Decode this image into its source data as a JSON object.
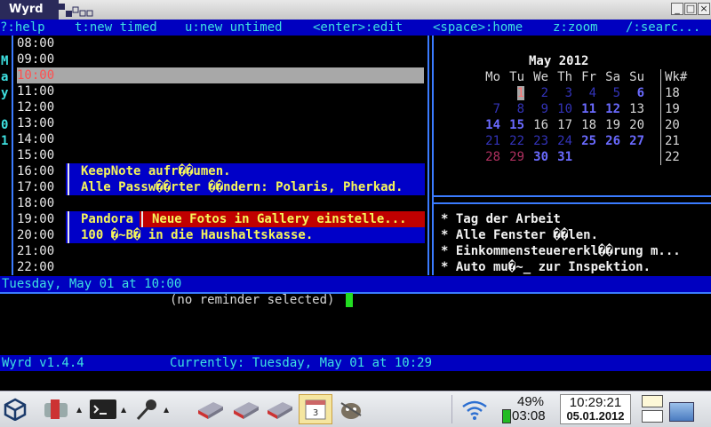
{
  "window": {
    "title": "Wyrd"
  },
  "menu": {
    "items": [
      "?:help",
      "t:new timed",
      "u:new untimed",
      "<enter>:edit",
      "<space>:home",
      "z:zoom",
      "/:searc..."
    ]
  },
  "sidebar": {
    "letters": [
      "M",
      "a",
      "y",
      "",
      "0",
      "1"
    ]
  },
  "timed": {
    "hours": [
      "08:00",
      "09:00",
      "10:00",
      "11:00",
      "12:00",
      "13:00",
      "14:00",
      "15:00",
      "16:00",
      "17:00",
      "18:00",
      "19:00",
      "20:00",
      "21:00",
      "22:00"
    ],
    "selected_index": 2,
    "events": {
      "e1": "KeepNote aufr��umen.",
      "e2": "Alle Passw��rter ��ndern: Polaris, Pherkad.",
      "e3": "Pandora",
      "e4": "Neue Fotos in Gallery einstelle...",
      "e5": "100 �~B� in die Haushaltskasse."
    }
  },
  "calendar": {
    "title": "May 2012",
    "weekdays": [
      "Mo",
      "Tu",
      "We",
      "Th",
      "Fr",
      "Sa",
      "Su"
    ],
    "wk_label": "Wk#",
    "rows": [
      {
        "days": [
          "",
          "1",
          "2",
          "3",
          "4",
          "5",
          "6"
        ],
        "wk": "18"
      },
      {
        "days": [
          "7",
          "8",
          "9",
          "10",
          "11",
          "12",
          "13"
        ],
        "wk": "19"
      },
      {
        "days": [
          "14",
          "15",
          "16",
          "17",
          "18",
          "19",
          "20"
        ],
        "wk": "20"
      },
      {
        "days": [
          "21",
          "22",
          "23",
          "24",
          "25",
          "26",
          "27"
        ],
        "wk": "21"
      },
      {
        "days": [
          "28",
          "29",
          "30",
          "31",
          "",
          "",
          ""
        ],
        "wk": "22"
      }
    ]
  },
  "untimed": {
    "items": [
      "* Tag der Arbeit",
      "* Alle Fenster ��len.",
      "* Einkommensteuererkl��rung m...",
      "* Auto mu�~_ zur Inspektion."
    ]
  },
  "status": {
    "date_line": "Tuesday, May 01 at 10:00",
    "reminder": "(no reminder selected)",
    "version": "Wyrd v1.4.4",
    "currently": "Currently: Tuesday, May 01 at 10:29"
  },
  "taskbar": {
    "battery": "49%",
    "battery_time": "03:08",
    "clock_time": "10:29:21",
    "clock_date": "05.01.2012",
    "calendar_icon_number": "3"
  }
}
